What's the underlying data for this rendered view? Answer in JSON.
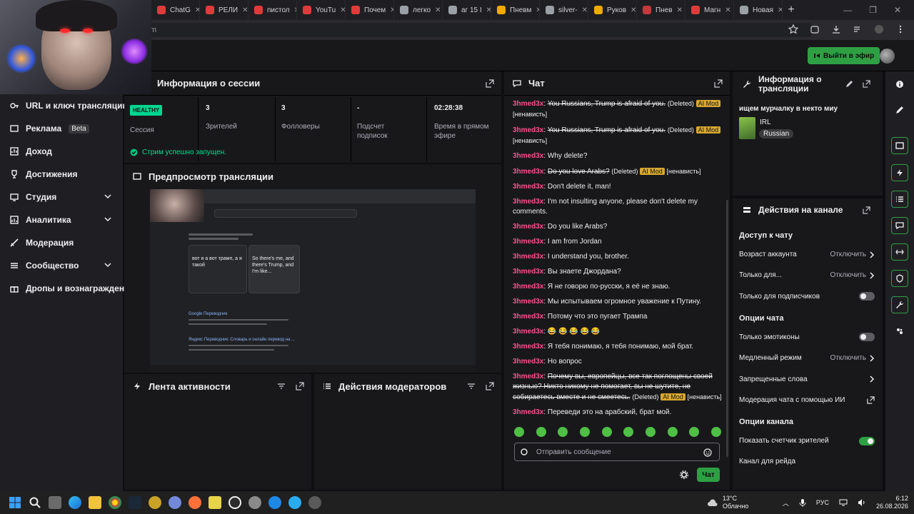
{
  "browser": {
    "tabs": [
      {
        "label": "ChatG",
        "color": "#e03b3b"
      },
      {
        "label": "РЕЛИ",
        "color": "#e03b3b"
      },
      {
        "label": "пистол",
        "color": "#e03b3b"
      },
      {
        "label": "YouTu",
        "color": "#e03b3b"
      },
      {
        "label": "Почем",
        "color": "#e03b3b"
      },
      {
        "label": "легко",
        "color": "#9aa0a6"
      },
      {
        "label": "аг 15 І",
        "color": "#9aa0a6"
      },
      {
        "label": "Пневм",
        "color": "#f2a900"
      },
      {
        "label": "silver-",
        "color": "#9aa0a6"
      },
      {
        "label": "Руков",
        "color": "#f2a900"
      },
      {
        "label": "Пнев",
        "color": "#c23a3a"
      },
      {
        "label": "Магн",
        "color": "#e03b3b"
      },
      {
        "label": "Новая",
        "color": "#9aa0a6"
      }
    ],
    "address_fragment": "m"
  },
  "header": {
    "go_live_label": "Выйти в эфир",
    "accent": "#2ea043"
  },
  "leftnav": {
    "items": [
      {
        "label": "URL и ключ трансляции",
        "icon": "key-icon",
        "chevron": false
      },
      {
        "label": "Реклама",
        "icon": "ad-icon",
        "chevron": false,
        "badge": "Beta"
      },
      {
        "label": "Доход",
        "icon": "revenue-icon",
        "chevron": false
      },
      {
        "label": "Достижения",
        "icon": "trophy-icon",
        "chevron": false
      },
      {
        "label": "Студия",
        "icon": "studio-icon",
        "chevron": true
      },
      {
        "label": "Аналитика",
        "icon": "analytics-icon",
        "chevron": true
      },
      {
        "label": "Модерация",
        "icon": "sword-icon",
        "chevron": false
      },
      {
        "label": "Сообщество",
        "icon": "community-icon",
        "chevron": true
      },
      {
        "label": "Дропы и вознаграждения",
        "icon": "drops-icon",
        "chevron": false
      }
    ]
  },
  "session": {
    "title": "Информация о сессии",
    "stats": [
      {
        "value": "HEALTHY",
        "label": "Сессия"
      },
      {
        "value": "3",
        "label": "Зрителей"
      },
      {
        "value": "3",
        "label": "Фолловеры"
      },
      {
        "value": "-",
        "label": "Подсчет подписок"
      },
      {
        "value": "02:28:38",
        "label": "Время в прямом эфире"
      }
    ],
    "status": "Стрим успешно запущен."
  },
  "preview": {
    "title": "Предпросмотр трансляции",
    "screen_text": {
      "left_box": "вот я а вот трамп, а я такой",
      "right_box": "So there's me, and there's Trump, and I'm like...",
      "result_title": "Google Переводчик",
      "result_title2": "Яндекс Переводчик: Словарь и онлайн перевод на ..."
    }
  },
  "activity": {
    "title": "Лента активности"
  },
  "modactions": {
    "title": "Действия модераторов"
  },
  "chat": {
    "title": "Чат",
    "messages": [
      {
        "user": "3hmed3x",
        "text": "You Russians, Trump is afraid of you.",
        "deleted": true,
        "tag": "(Deleted)",
        "ai": "AI Mod",
        "reason": "[ненависть]"
      },
      {
        "user": "3hmed3x",
        "text": "You Russians, Trump is afraid of you.",
        "deleted": true,
        "tag": "(Deleted)",
        "ai": "AI Mod",
        "reason": "[ненависть]"
      },
      {
        "user": "3hmed3x",
        "text": "Why delete?",
        "deleted": false
      },
      {
        "user": "3hmed3x",
        "text": "Do you love Arabs?",
        "deleted": true,
        "tag": "(Deleted)",
        "ai": "AI Mod",
        "reason": "[ненависть]"
      },
      {
        "user": "3hmed3x",
        "text": "Don't delete it, man!",
        "deleted": false
      },
      {
        "user": "3hmed3x",
        "text": "I'm not insulting anyone, please don't delete my comments.",
        "deleted": false
      },
      {
        "user": "3hmed3x",
        "text": "Do you like Arabs?",
        "deleted": false
      },
      {
        "user": "3hmed3x",
        "text": "I am from Jordan",
        "deleted": false
      },
      {
        "user": "3hmed3x",
        "text": "I understand you, brother.",
        "deleted": false
      },
      {
        "user": "3hmed3x",
        "text": "Вы знаете Джордана?",
        "deleted": false
      },
      {
        "user": "3hmed3x",
        "text": "Я не говорю по-русски, я её не знаю.",
        "deleted": false
      },
      {
        "user": "3hmed3x",
        "text": "Мы испытываем огромное уважение к Путину.",
        "deleted": false
      },
      {
        "user": "3hmed3x",
        "text": "Потому что это пугает Трампа",
        "deleted": false
      },
      {
        "user": "3hmed3x",
        "text": "😂 😂 😂 😂 😂",
        "deleted": false
      },
      {
        "user": "3hmed3x",
        "text": "Я тебя понимаю, я тебя понимаю, мой брат.",
        "deleted": false
      },
      {
        "user": "3hmed3x",
        "text": "Но вопрос",
        "deleted": false
      },
      {
        "user": "3hmed3x",
        "text": "Почему вы, европейцы, все так поглощены своей жизнью? Никто никому не помогает, вы не шутите, не собираетесь вместе и не смеетесь.",
        "deleted": true,
        "tag": "(Deleted)",
        "ai": "AI Mod",
        "reason": "[ненависть]"
      },
      {
        "user": "3hmed3x",
        "text": "Переведи это на арабский, брат мой.",
        "deleted": false
      }
    ],
    "input_placeholder": "Отправить сообщение",
    "send_label": "Чат"
  },
  "stream_info": {
    "title": "Информация о трансляции",
    "stream_title": "ищем мурчалку в некто миу",
    "category": "IRL",
    "tag": "Russian"
  },
  "channel_actions": {
    "title": "Действия на канале",
    "sections": [
      {
        "heading": "Доступ к чату",
        "rows": [
          {
            "label": "Возраст аккаунта",
            "value": "Отключить",
            "kind": "chevron"
          },
          {
            "label": "Только для...",
            "value": "Отключить",
            "kind": "chevron"
          },
          {
            "label": "Только для подписчиков",
            "value": "",
            "kind": "toggle",
            "on": false
          }
        ]
      },
      {
        "heading": "Опции чата",
        "rows": [
          {
            "label": "Только эмотиконы",
            "value": "",
            "kind": "toggle",
            "on": false
          },
          {
            "label": "Медленный режим",
            "value": "Отключить",
            "kind": "chevron"
          },
          {
            "label": "Запрещенные слова",
            "value": "",
            "kind": "chevron"
          },
          {
            "label": "Модерация чата с помощью ИИ",
            "value": "",
            "kind": "external"
          }
        ]
      },
      {
        "heading": "Опции канала",
        "rows": [
          {
            "label": "Показать счетчик зрителей",
            "value": "",
            "kind": "toggle",
            "on": true
          },
          {
            "label": "Канал для рейда",
            "value": "",
            "kind": "none"
          }
        ]
      }
    ]
  },
  "taskbar": {
    "weather_temp": "13°C",
    "weather_desc": "Облачно",
    "lang": "РУС",
    "time": "6:12",
    "date": "26.08.2026"
  }
}
